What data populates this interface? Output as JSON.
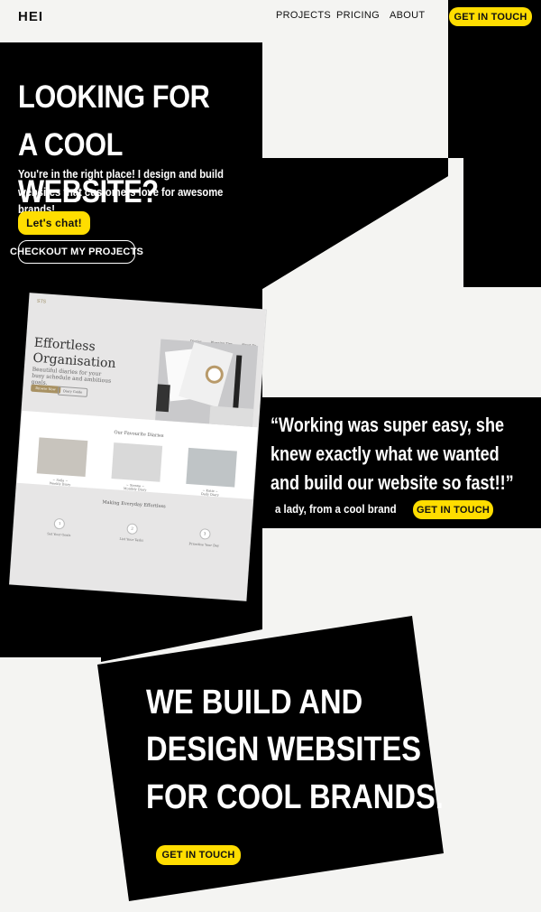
{
  "header": {
    "logo": "HEI",
    "nav": [
      {
        "label": "PROJECTS"
      },
      {
        "label": "PRICING"
      },
      {
        "label": "ABOUT"
      }
    ],
    "cta": "GET IN TOUCH"
  },
  "hero": {
    "title_line1": "LOOKING FOR",
    "title_line2": "A COOL WEBSITE?",
    "subtitle_line1": "You're in the right place! I design and build",
    "subtitle_line2": "websites that customers love for awesome brands!",
    "chat_button": "Let's chat!",
    "projects_button": "CHECKOUT MY PROJECTS"
  },
  "mockup": {
    "brand": "STS",
    "nav": [
      "Diaries",
      "Planning Tips",
      "About Us"
    ],
    "title_line1": "Effortless",
    "title_line2": "Organisation",
    "tagline": "Beautiful diaries for your busy schedule and ambitious goals.",
    "btn_primary": "Browse Now",
    "btn_secondary": "Diary Guide",
    "favourites_title": "Our Favourite Diaries",
    "products": [
      {
        "name": "~ Sofia ~",
        "desc": "Weekly Diary",
        "button": "Shop Now"
      },
      {
        "name": "~ Sienna ~",
        "desc": "Monthly Diary",
        "button": "Shop Now"
      },
      {
        "name": "~ Katie ~",
        "desc": "Daily Diary",
        "button": "Shop Now"
      }
    ],
    "steps_title": "Making Everyday Effortless",
    "steps": [
      {
        "num": "1",
        "title": "Set Your Goals"
      },
      {
        "num": "2",
        "title": "List Your Tasks"
      },
      {
        "num": "3",
        "title": "Prioritise Your Day"
      }
    ]
  },
  "testimonial": {
    "line1": "“Working was super easy,  she",
    "line2": "knew exactly what we wanted",
    "line3": "and build our website so fast!!”",
    "author": "a lady, from a cool brand",
    "cta": "GET IN TOUCH"
  },
  "closing": {
    "line1": "WE BUILD AND",
    "line2": "DESIGN WEBSITES",
    "line3": "FOR COOL BRANDS.",
    "cta": "GET IN TOUCH"
  },
  "colors": {
    "accent": "#ffdd00",
    "dark": "#000000",
    "background": "#f4f4f2"
  }
}
